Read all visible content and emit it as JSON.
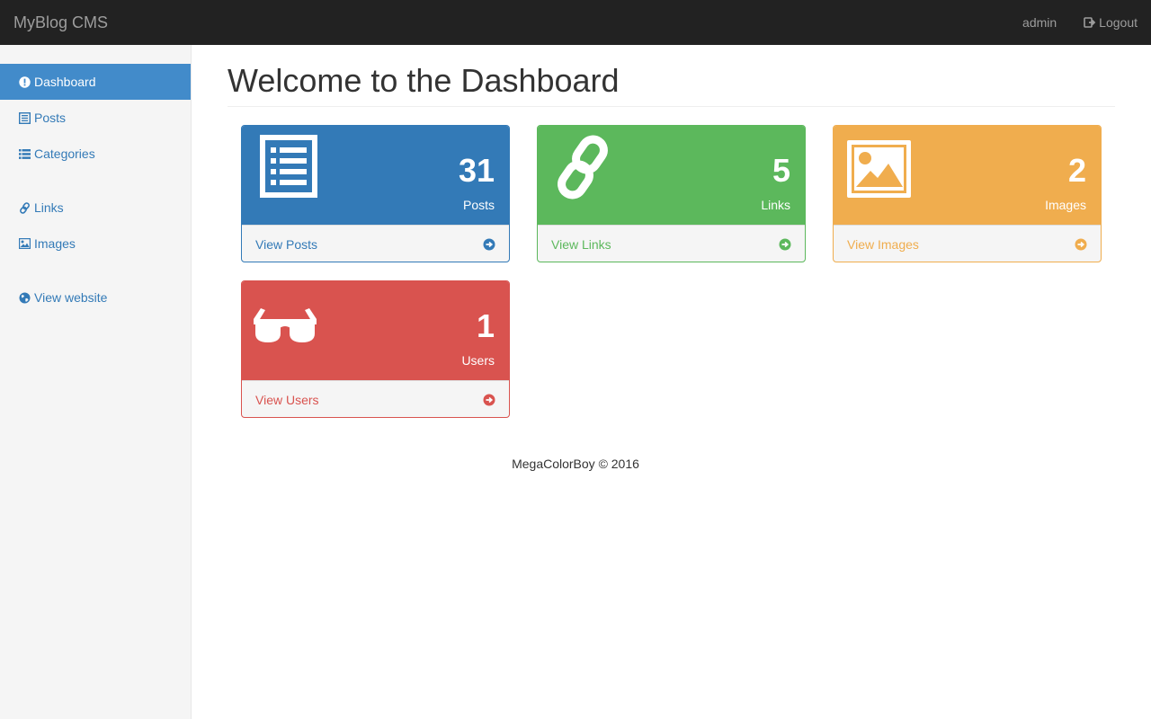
{
  "navbar": {
    "brand": "MyBlog CMS",
    "user": "admin",
    "logout": "Logout"
  },
  "sidebar": {
    "items": [
      {
        "label": "Dashboard",
        "icon": "exclamation-circle-icon",
        "active": true
      },
      {
        "label": "Posts",
        "icon": "list-alt-icon"
      },
      {
        "label": "Categories",
        "icon": "list-icon"
      },
      {
        "label": "Links",
        "icon": "link-icon"
      },
      {
        "label": "Images",
        "icon": "picture-icon"
      },
      {
        "label": "View website",
        "icon": "globe-icon"
      }
    ]
  },
  "main": {
    "title": "Welcome to the Dashboard",
    "panels": [
      {
        "count": "31",
        "label": "Posts",
        "link": "View Posts",
        "color": "#337ab7",
        "icon": "list-alt-icon"
      },
      {
        "count": "5",
        "label": "Links",
        "link": "View Links",
        "color": "#5cb85c",
        "icon": "link-icon"
      },
      {
        "count": "2",
        "label": "Images",
        "link": "View Images",
        "color": "#f0ad4e",
        "icon": "picture-icon"
      },
      {
        "count": "1",
        "label": "Users",
        "link": "View Users",
        "color": "#d9534f",
        "icon": "sunglasses-icon"
      }
    ]
  },
  "footer": {
    "text": "MegaColorBoy © 2016"
  },
  "colors": {
    "navbar": "#222222",
    "sidebar": "#f5f5f5",
    "active": "#428bca",
    "link": "#337ab7"
  }
}
